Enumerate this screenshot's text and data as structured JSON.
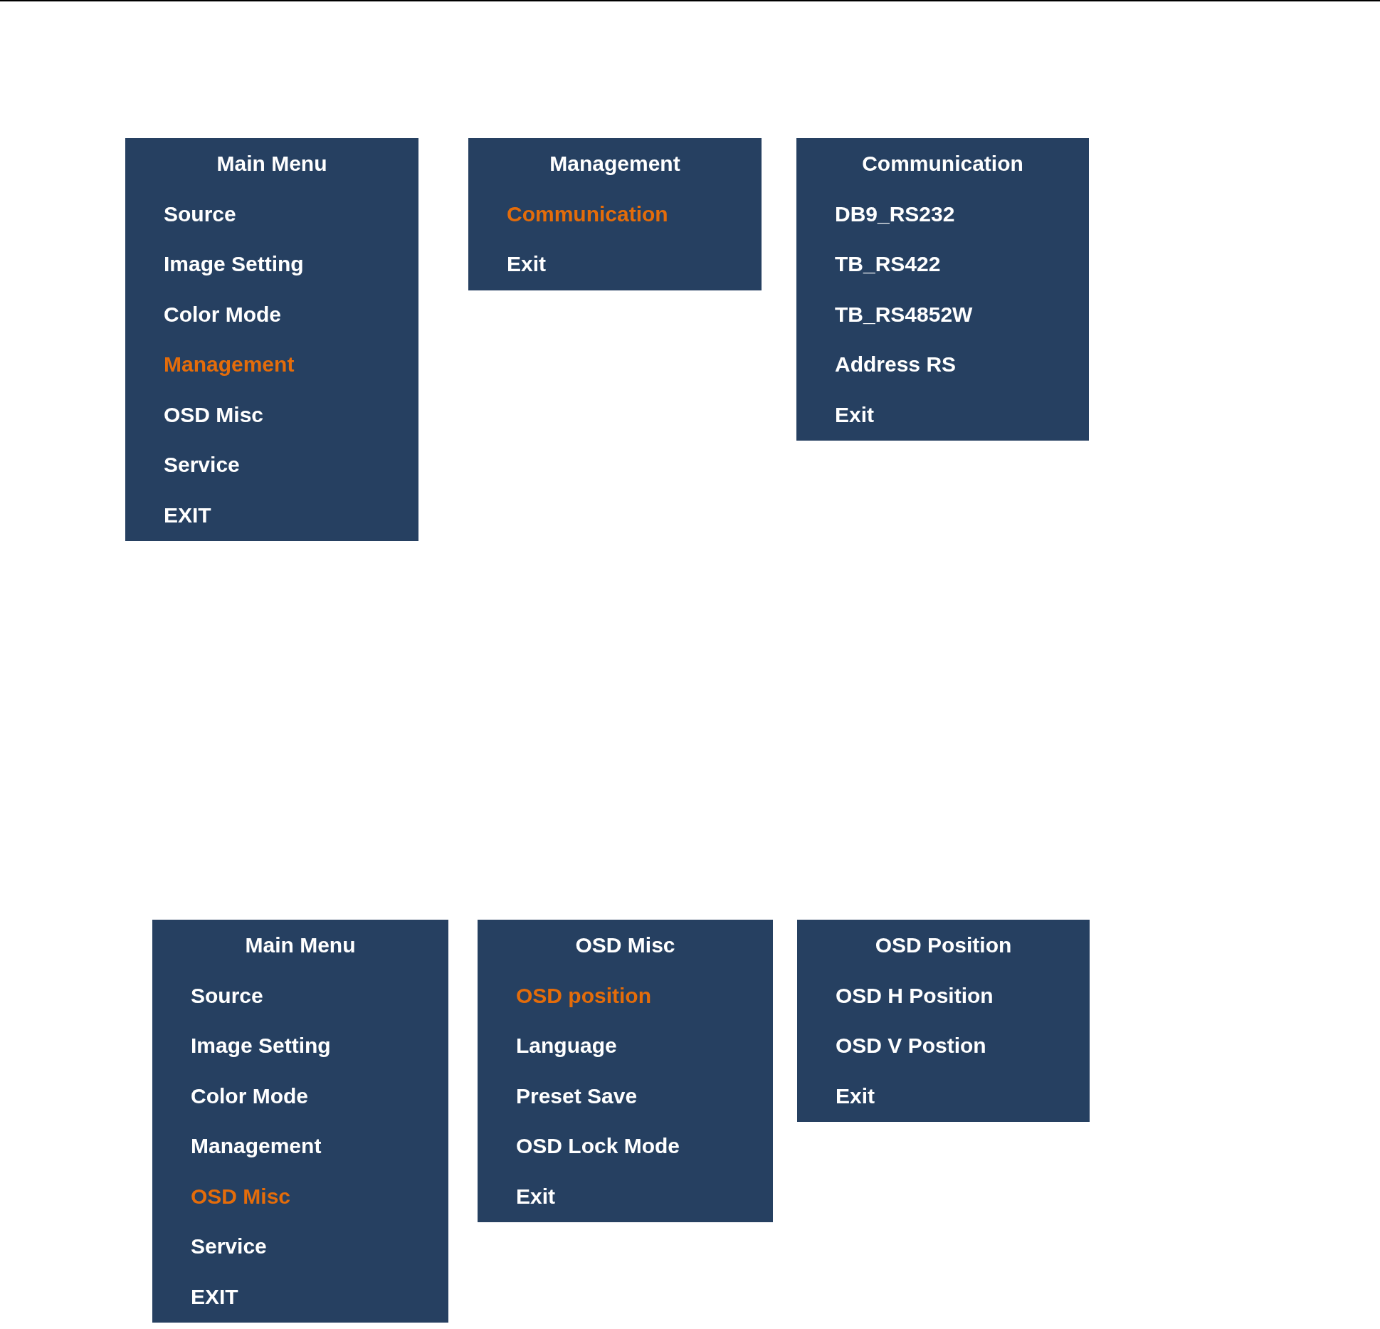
{
  "menu_groups": [
    {
      "panels": [
        {
          "title": "Main Menu",
          "items": [
            {
              "label": "Source",
              "selected": false
            },
            {
              "label": "Image Setting",
              "selected": false
            },
            {
              "label": "Color Mode",
              "selected": false
            },
            {
              "label": "Management",
              "selected": true
            },
            {
              "label": "OSD Misc",
              "selected": false
            },
            {
              "label": "Service",
              "selected": false
            },
            {
              "label": "EXIT",
              "selected": false
            }
          ]
        },
        {
          "title": "Management",
          "items": [
            {
              "label": "Communication",
              "selected": true
            },
            {
              "label": "Exit",
              "selected": false
            }
          ]
        },
        {
          "title": "Communication",
          "items": [
            {
              "label": "DB9_RS232",
              "selected": false
            },
            {
              "label": "TB_RS422",
              "selected": false
            },
            {
              "label": "TB_RS4852W",
              "selected": false
            },
            {
              "label": "Address RS",
              "selected": false
            },
            {
              "label": "Exit",
              "selected": false
            }
          ]
        }
      ]
    },
    {
      "panels": [
        {
          "title": "Main Menu",
          "items": [
            {
              "label": "Source",
              "selected": false
            },
            {
              "label": "Image Setting",
              "selected": false
            },
            {
              "label": "Color Mode",
              "selected": false
            },
            {
              "label": "Management",
              "selected": false
            },
            {
              "label": "OSD Misc",
              "selected": true
            },
            {
              "label": "Service",
              "selected": false
            },
            {
              "label": "EXIT",
              "selected": false
            }
          ]
        },
        {
          "title": "OSD Misc",
          "items": [
            {
              "label": "OSD position",
              "selected": true
            },
            {
              "label": "Language",
              "selected": false
            },
            {
              "label": "Preset Save",
              "selected": false
            },
            {
              "label": "OSD Lock Mode",
              "selected": false
            },
            {
              "label": "Exit",
              "selected": false
            }
          ]
        },
        {
          "title": "OSD Position",
          "items": [
            {
              "label": "OSD H Position",
              "selected": false
            },
            {
              "label": "OSD V Postion",
              "selected": false
            },
            {
              "label": "Exit",
              "selected": false
            }
          ]
        }
      ]
    }
  ]
}
